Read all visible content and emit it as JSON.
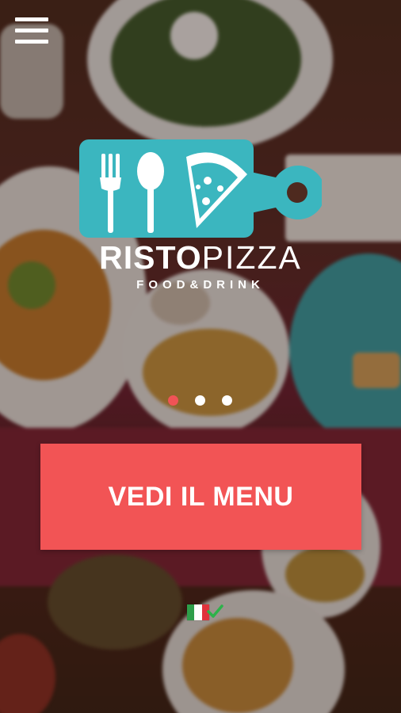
{
  "header": {
    "menu_icon": "hamburger-menu-icon"
  },
  "logo": {
    "brand_bold": "RISTO",
    "brand_light": "PIZZA",
    "tagline": "FOOD&DRINK",
    "icons": [
      "fork-icon",
      "spoon-icon",
      "pizza-slice-icon"
    ],
    "board_color": "#3bb6bf"
  },
  "carousel": {
    "slides": 3,
    "active_index": 0,
    "active_color": "#f05356",
    "inactive_color": "#ffffff"
  },
  "cta": {
    "label": "VEDI IL MENU",
    "color": "#f25455"
  },
  "language": {
    "current": "italian-flag-icon",
    "selected_indicator": "check-icon"
  }
}
